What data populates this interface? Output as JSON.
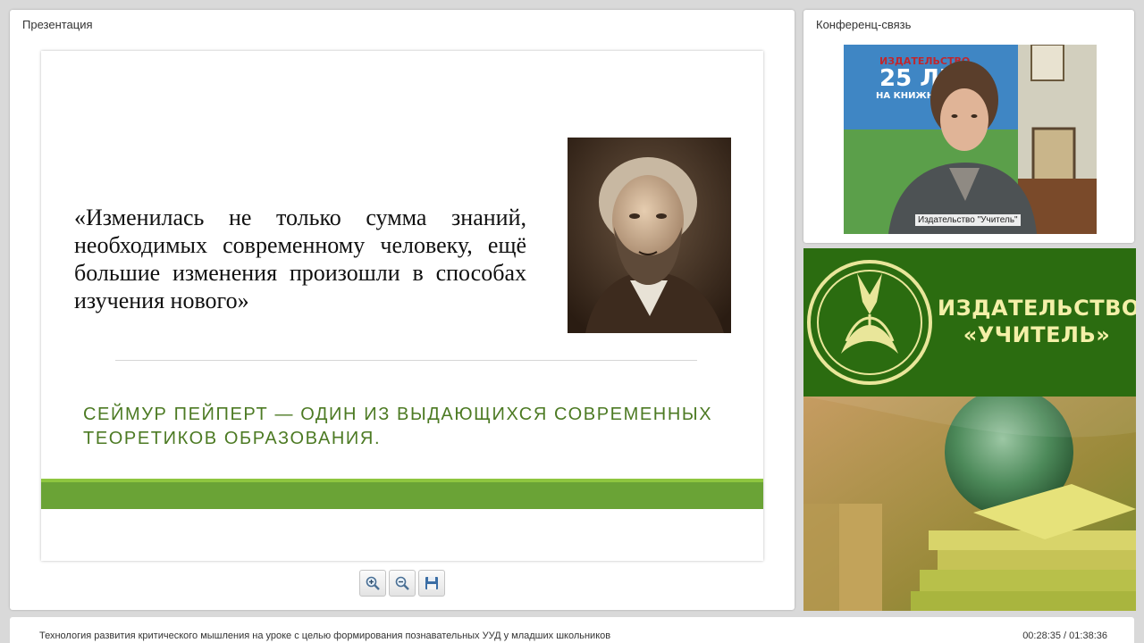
{
  "presentation": {
    "title": "Презентация",
    "slide": {
      "quote": "«Изменилась не только сумма знаний, необходимых современному человеку, ещё большие изменения произошли в способах изучения нового»",
      "caption": "СЕЙМУР ПЕЙПЕРТ — ОДИН ИЗ ВЫДАЮЩИХСЯ СОВРЕМЕННЫХ ТЕОРЕТИКОВ ОБРАЗОВАНИЯ."
    },
    "toolbar": {
      "zoom_in_icon": "zoom-in-icon",
      "zoom_out_icon": "zoom-out-icon",
      "save_icon": "save-icon"
    }
  },
  "conference": {
    "title": "Конференц-связь",
    "participant_label": "Издательство \"Учитель\"",
    "backdrop_text": {
      "line1": "ИЗДАТЕЛЬСТВО",
      "line2": "25 ЛЕТ",
      "line3": "НА КНИЖНО"
    }
  },
  "banner": {
    "line1": "ИЗДАТЕЛЬСТВО",
    "line2": "«УЧИТЕЛЬ»"
  },
  "bottom_bar": {
    "lecture_title": "Технология развития критического мышления на уроке с целью формирования познавательных УУД у младших школьников",
    "time": "00:28:35 / 01:38:36"
  },
  "colors": {
    "accent_green": "#6aa336",
    "caption_green": "#4c7a23",
    "banner_green": "#2a6a0f",
    "banner_text": "#f4f0a8"
  }
}
